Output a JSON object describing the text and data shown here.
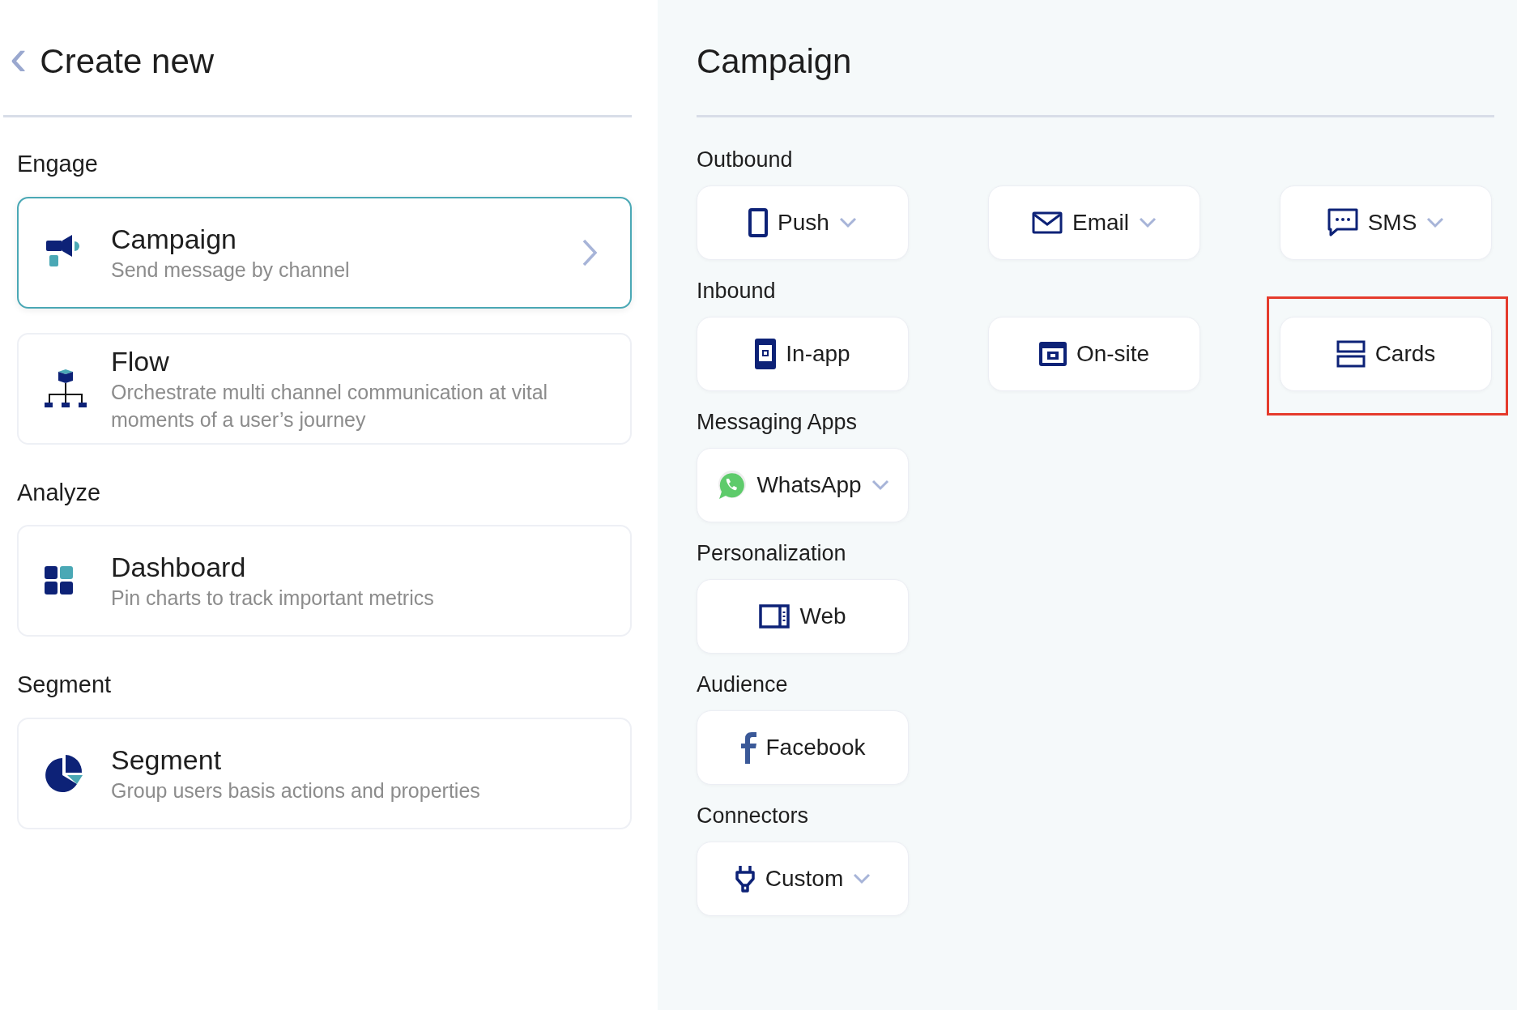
{
  "left": {
    "back": "‹",
    "title": "Create new",
    "groups": [
      {
        "label": "Engage",
        "items": [
          {
            "title": "Campaign",
            "description": "Send message by channel",
            "selected": true
          },
          {
            "title": "Flow",
            "description": "Orchestrate multi channel communication at vital moments of a user’s journey",
            "selected": false
          }
        ]
      },
      {
        "label": "Analyze",
        "items": [
          {
            "title": "Dashboard",
            "description": "Pin charts to track important metrics",
            "selected": false
          }
        ]
      },
      {
        "label": "Segment",
        "items": [
          {
            "title": "Segment",
            "description": "Group users basis actions and properties",
            "selected": false
          }
        ]
      }
    ]
  },
  "right": {
    "title": "Campaign",
    "sections": [
      {
        "label": "Outbound",
        "buttons": [
          {
            "label": "Push",
            "dropdown": true,
            "highlighted": false
          },
          {
            "label": "Email",
            "dropdown": true,
            "highlighted": false
          },
          {
            "label": "SMS",
            "dropdown": true,
            "highlighted": false
          }
        ]
      },
      {
        "label": "Inbound",
        "buttons": [
          {
            "label": "In-app",
            "dropdown": false,
            "highlighted": false
          },
          {
            "label": "On-site",
            "dropdown": false,
            "highlighted": false
          },
          {
            "label": "Cards",
            "dropdown": false,
            "highlighted": true
          }
        ]
      },
      {
        "label": "Messaging Apps",
        "buttons": [
          {
            "label": "WhatsApp",
            "dropdown": true,
            "highlighted": false
          }
        ]
      },
      {
        "label": "Personalization",
        "buttons": [
          {
            "label": "Web",
            "dropdown": false,
            "highlighted": false
          }
        ]
      },
      {
        "label": "Audience",
        "buttons": [
          {
            "label": "Facebook",
            "dropdown": false,
            "highlighted": false
          }
        ]
      },
      {
        "label": "Connectors",
        "buttons": [
          {
            "label": "Custom",
            "dropdown": true,
            "highlighted": false
          }
        ]
      }
    ]
  }
}
